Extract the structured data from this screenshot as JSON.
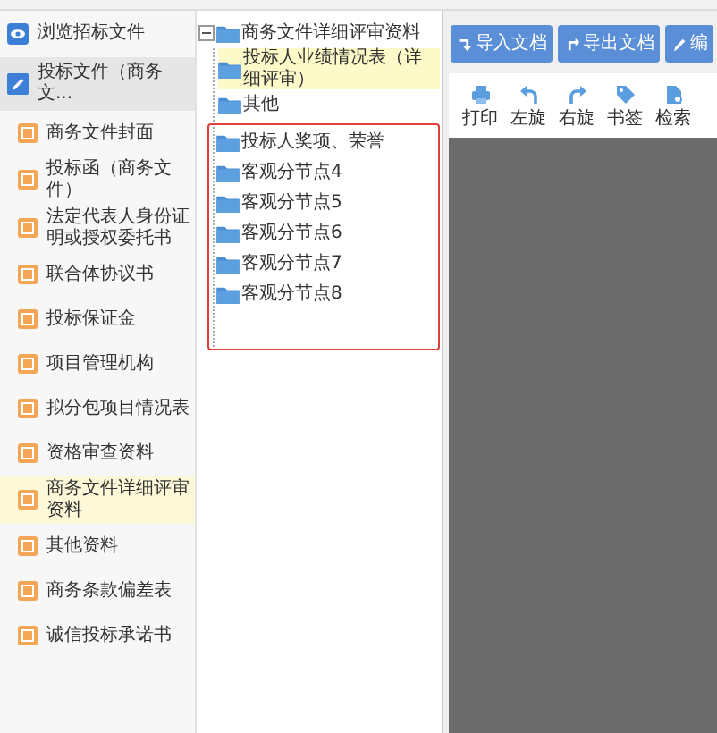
{
  "sidebar": {
    "sections": [
      {
        "label": "浏览招标文件",
        "kind": "browse",
        "selected": false
      },
      {
        "label": "投标文件（商务文...",
        "kind": "edit",
        "selected": true
      }
    ],
    "items": [
      {
        "label": "商务文件封面",
        "selected": false
      },
      {
        "label": "投标函（商务文件）",
        "selected": false
      },
      {
        "label": "法定代表人身份证明或授权委托书",
        "selected": false
      },
      {
        "label": "联合体协议书",
        "selected": false
      },
      {
        "label": "投标保证金",
        "selected": false
      },
      {
        "label": "项目管理机构",
        "selected": false
      },
      {
        "label": "拟分包项目情况表",
        "selected": false
      },
      {
        "label": "资格审查资料",
        "selected": false
      },
      {
        "label": "商务文件详细评审资料",
        "selected": true
      },
      {
        "label": "其他资料",
        "selected": false
      },
      {
        "label": "商务条款偏差表",
        "selected": false
      },
      {
        "label": "诚信投标承诺书",
        "selected": false
      }
    ]
  },
  "tree": {
    "label": "商务文件详细评审资料",
    "expanded": true,
    "children": [
      {
        "label": "投标人业绩情况表（详细评审）",
        "selected": true,
        "outlined": false
      },
      {
        "label": "其他",
        "selected": false,
        "outlined": false
      },
      {
        "label": "投标人奖项、荣誉",
        "selected": false,
        "outlined": true
      },
      {
        "label": "客观分节点4",
        "selected": false,
        "outlined": true
      },
      {
        "label": "客观分节点5",
        "selected": false,
        "outlined": true
      },
      {
        "label": "客观分节点6",
        "selected": false,
        "outlined": true
      },
      {
        "label": "客观分节点7",
        "selected": false,
        "outlined": true
      },
      {
        "label": "客观分节点8",
        "selected": false,
        "outlined": true
      }
    ]
  },
  "actions": [
    {
      "label": "导入文档",
      "kind": "import"
    },
    {
      "label": "导出文档",
      "kind": "export"
    },
    {
      "label": "编",
      "kind": "edit"
    }
  ],
  "viewer_tools": [
    {
      "label": "打印",
      "kind": "print"
    },
    {
      "label": "左旋",
      "kind": "rotate-left"
    },
    {
      "label": "右旋",
      "kind": "rotate-right"
    },
    {
      "label": "书签",
      "kind": "bookmark"
    },
    {
      "label": "检索",
      "kind": "search"
    }
  ]
}
